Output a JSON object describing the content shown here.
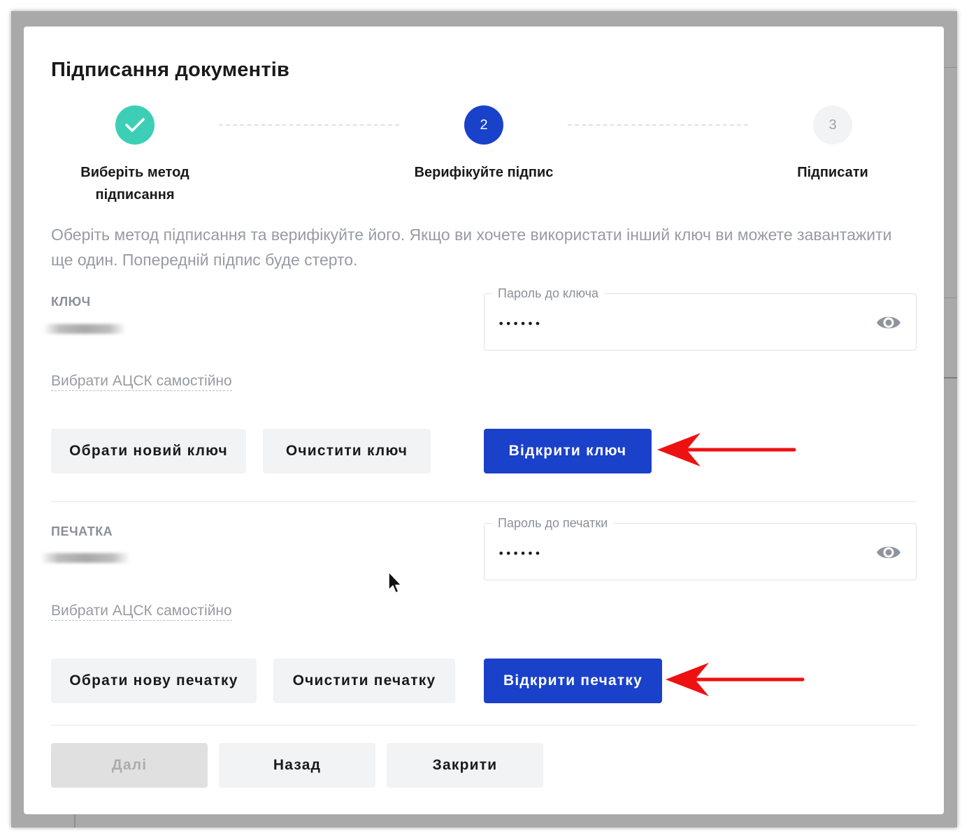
{
  "dialog": {
    "title": "Підписання документів"
  },
  "stepper": {
    "steps": [
      {
        "number": "1",
        "label": "Виберіть метод підписання",
        "state": "completed",
        "color": "#3ccfb6"
      },
      {
        "number": "2",
        "label": "Верифікуйте підпис",
        "state": "active",
        "color": "#1a41c9"
      },
      {
        "number": "3",
        "label": "Підписати",
        "state": "pending",
        "color": "#f2f3f5"
      }
    ]
  },
  "description": "Оберіть метод підписання та верифікуйте його. Якщо ви хочете використати інший ключ ви можете завантажити ще один. Попередній підпис буде стерто.",
  "key_section": {
    "label": "КЛЮЧ",
    "password_label": "Пароль до ключа",
    "password_value": "••••••",
    "acsk_link": "Вибрати АЦСК самостійно",
    "choose_button": "Обрати новий ключ",
    "clear_button": "Очистити ключ",
    "open_button": "Відкрити ключ"
  },
  "seal_section": {
    "label": "ПЕЧАТКА",
    "password_label": "Пароль до печатки",
    "password_value": "••••••",
    "acsk_link": "Вибрати АЦСК самостійно",
    "choose_button": "Обрати нову печатку",
    "clear_button": "Очистити печатку",
    "open_button": "Відкрити печатку"
  },
  "footer": {
    "next_button": "Далі",
    "back_button": "Назад",
    "close_button": "Закрити"
  },
  "colors": {
    "primary": "#1a41c9",
    "success": "#3ccfb6",
    "annotation_arrow": "#ee1111"
  },
  "icons": [
    "check-icon",
    "eye-icon",
    "mouse-cursor-icon",
    "annotation-arrow"
  ]
}
